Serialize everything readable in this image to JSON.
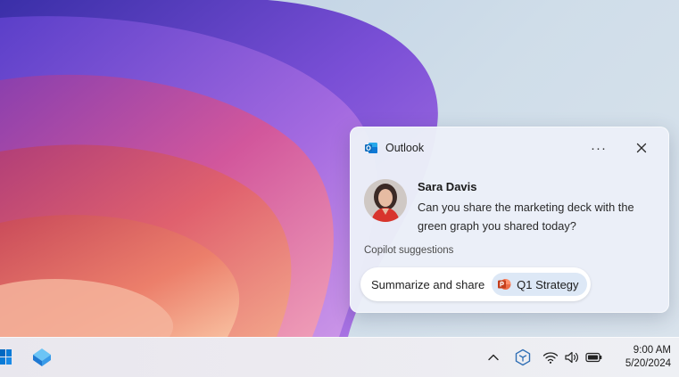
{
  "notification": {
    "app_name": "Outlook",
    "more_label": "···",
    "sender": "Sara Davis",
    "message": "Can you share the marketing deck with the green graph you shared today?",
    "suggestions_label": "Copilot suggestions",
    "suggestion": {
      "action": "Summarize and share",
      "file_name": "Q1 Strategy"
    }
  },
  "taskbar": {
    "time": "9:00 AM",
    "date": "5/20/2024",
    "icons": [
      "start-icon",
      "app-icon",
      "chevron-up-icon",
      "copilot-icon",
      "wifi-icon",
      "volume-icon",
      "battery-icon"
    ]
  },
  "colors": {
    "outlook_blue": "#0f6cbd",
    "powerpoint_orange": "#c43e1c",
    "chip_bg": "#dde8f6"
  }
}
